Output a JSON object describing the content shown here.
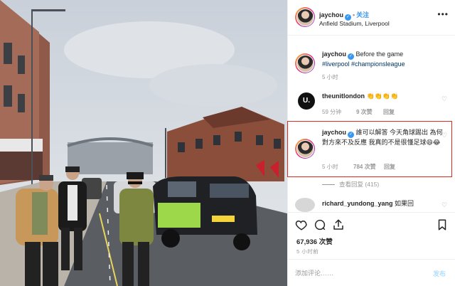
{
  "header": {
    "username": "jaychou",
    "follow_label": "关注",
    "location": "Anfield Stadium, Liverpool",
    "more_icon": "more-horizontal-icon"
  },
  "caption": {
    "username": "jaychou",
    "text": "Before the game",
    "tags": "#liverpool #championsleague",
    "time": "5 小时"
  },
  "comments": [
    {
      "username": "theunitlondon",
      "text": "👏👏👏👏",
      "time": "59 分钟",
      "likes": "9 次赞",
      "reply": "回复"
    },
    {
      "username": "jaychou",
      "text": "誰可以解答 今天角球踢出 為何對方來不及反應 我真的不是很懂足球😄😂",
      "time": "5 小时",
      "likes": "784 次赞",
      "reply": "回复"
    },
    {
      "username": "richard_yundong_yang",
      "text": "如果回"
    }
  ],
  "view_replies": "查看回复 (415)",
  "actions": {
    "likes": "67,936 次赞",
    "time": "5 小时前"
  },
  "add_comment": {
    "placeholder": "添加评论……",
    "post_label": "发布"
  },
  "colors": {
    "accent": "#3897f0",
    "highlight": "#e02b20",
    "muted": "#999999"
  }
}
